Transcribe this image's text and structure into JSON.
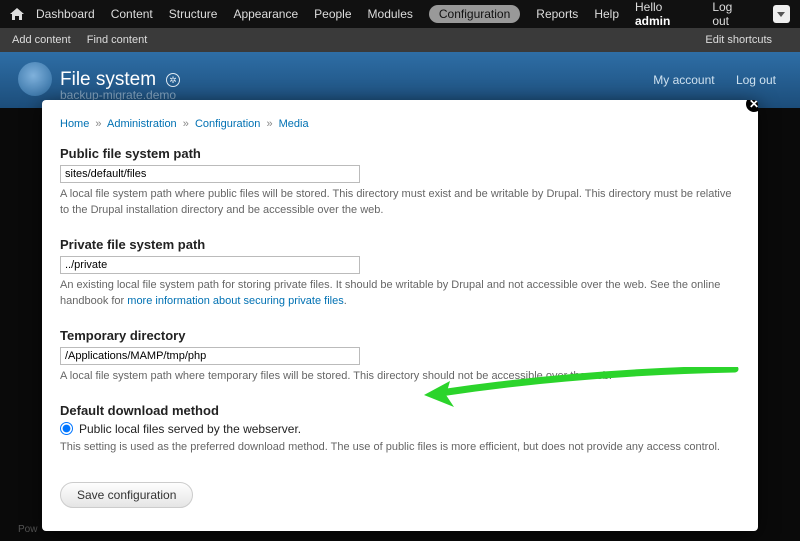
{
  "toolbar": {
    "items": [
      {
        "label": "Dashboard"
      },
      {
        "label": "Content"
      },
      {
        "label": "Structure"
      },
      {
        "label": "Appearance"
      },
      {
        "label": "People"
      },
      {
        "label": "Modules"
      },
      {
        "label": "Configuration",
        "active": true
      },
      {
        "label": "Reports"
      },
      {
        "label": "Help"
      }
    ],
    "hello_prefix": "Hello ",
    "hello_user": "admin",
    "logout": "Log out"
  },
  "shortcuts": {
    "add_content": "Add content",
    "find_content": "Find content",
    "edit_shortcuts": "Edit shortcuts"
  },
  "header": {
    "title": "File system",
    "subtitle": "backup-migrate.demo",
    "my_account": "My account",
    "logout": "Log out"
  },
  "breadcrumb": {
    "home": "Home",
    "admin": "Administration",
    "config": "Configuration",
    "media": "Media"
  },
  "form": {
    "public": {
      "label": "Public file system path",
      "value": "sites/default/files",
      "desc": "A local file system path where public files will be stored. This directory must exist and be writable by Drupal. This directory must be relative to the Drupal installation directory and be accessible over the web."
    },
    "private": {
      "label": "Private file system path",
      "value": "../private",
      "desc_pre": "An existing local file system path for storing private files. It should be writable by Drupal and not accessible over the web. See the online handbook for ",
      "desc_link": "more information about securing private files",
      "desc_post": "."
    },
    "temp": {
      "label": "Temporary directory",
      "value": "/Applications/MAMP/tmp/php",
      "desc": "A local file system path where temporary files will be stored. This directory should not be accessible over the web."
    },
    "download": {
      "label": "Default download method",
      "option": "Public local files served by the webserver.",
      "desc": "This setting is used as the preferred download method. The use of public files is more efficient, but does not provide any access control."
    },
    "save": "Save configuration"
  },
  "footer": "Pow"
}
